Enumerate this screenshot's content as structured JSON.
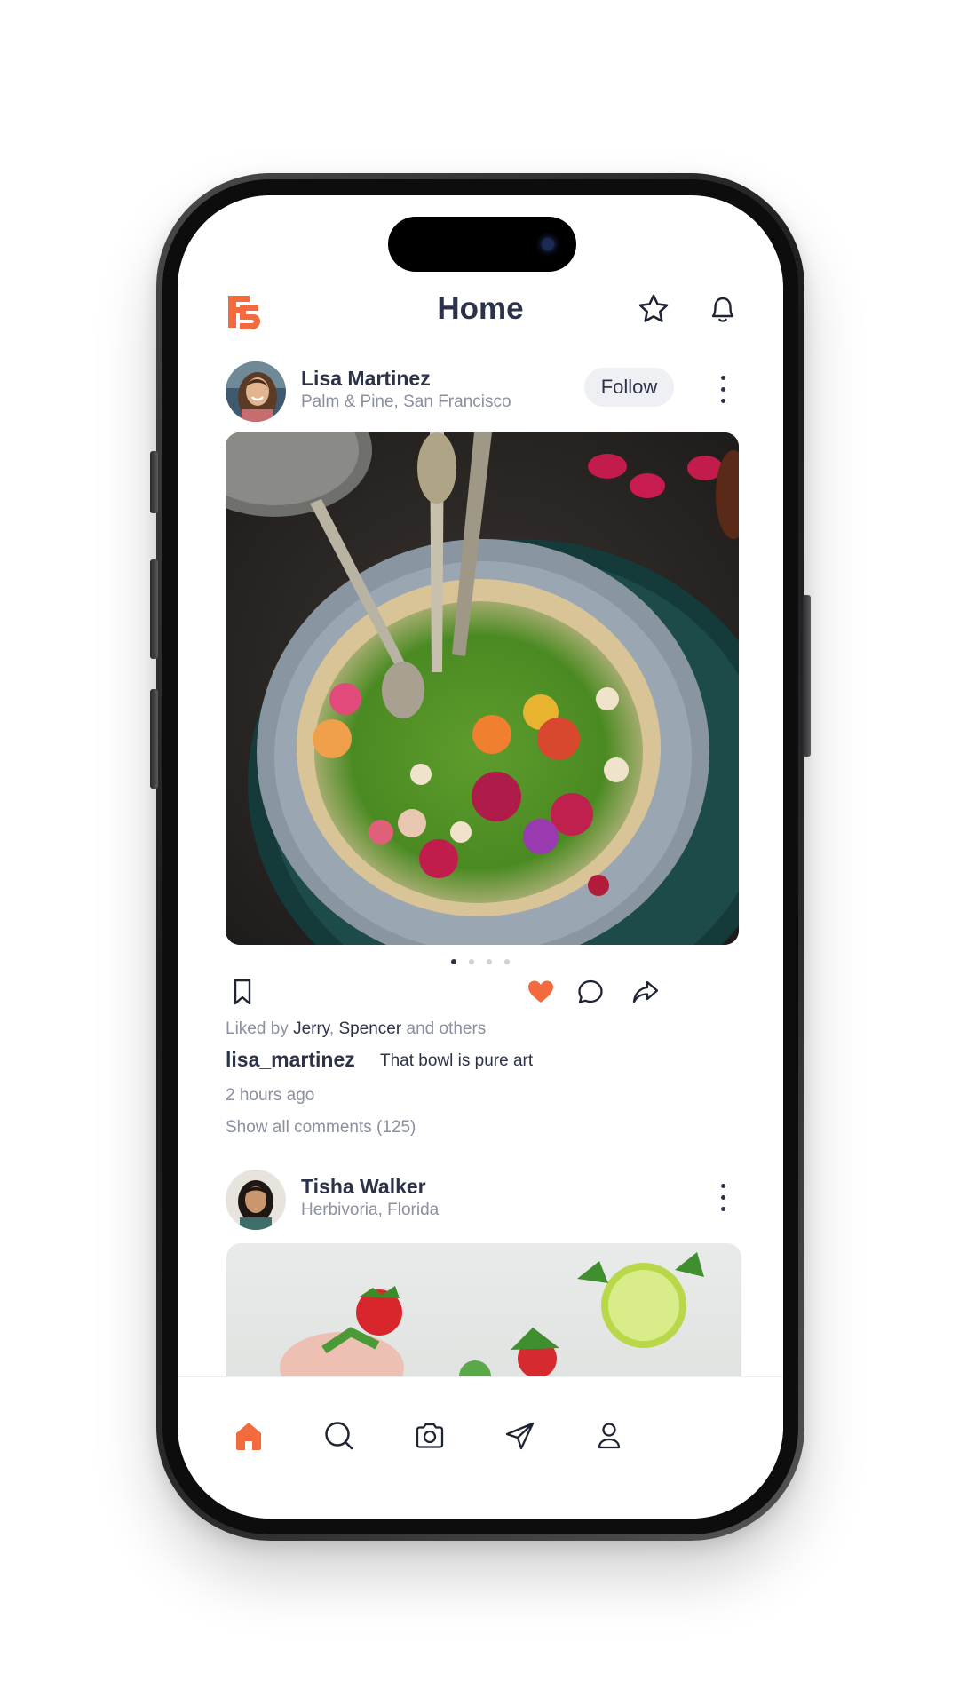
{
  "header": {
    "title": "Home"
  },
  "colors": {
    "accent": "#f26a3d",
    "text_primary": "#2c3348",
    "text_secondary": "#8b90a0"
  },
  "icons": {
    "header": [
      "logo-icon",
      "star-icon",
      "bell-icon"
    ],
    "post_actions": [
      "bookmark-icon",
      "heart-icon",
      "comment-icon",
      "share-icon"
    ],
    "tabbar": [
      "home-icon",
      "search-icon",
      "camera-icon",
      "send-icon",
      "profile-icon"
    ]
  },
  "posts": [
    {
      "name": "Lisa Martinez",
      "location": "Palm & Pine, San Francisco",
      "follow_label": "Follow",
      "carousel": {
        "count": 4,
        "active": 1
      },
      "liked_prefix": "Liked by",
      "liked_user1": "Jerry",
      "liked_sep": ",",
      "liked_user2": "Spencer",
      "liked_suffix": "and others",
      "username": "lisa_martinez",
      "caption": "That bowl is pure art",
      "time": "2 hours ago",
      "comments_link": "Show all comments (125)",
      "liked": true
    },
    {
      "name": "Tisha Walker",
      "location": "Herbivoria, Florida"
    }
  ],
  "tabbar": {
    "active": "home"
  }
}
